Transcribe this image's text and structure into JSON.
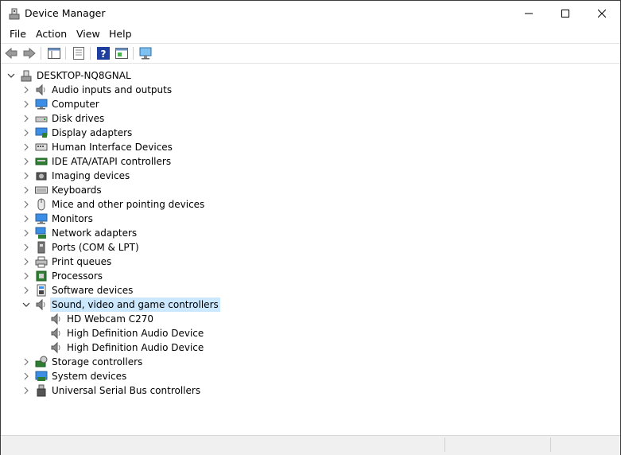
{
  "window": {
    "title": "Device Manager"
  },
  "menu": [
    "File",
    "Action",
    "View",
    "Help"
  ],
  "toolbar": {
    "buttons": [
      "back-icon",
      "forward-icon",
      "properties-icon",
      "update-driver-icon",
      "help-icon",
      "view-hidden-icon",
      "scan-hardware-icon"
    ]
  },
  "tree": {
    "root": "DESKTOP-NQ8GNAL",
    "categories": [
      {
        "label": "Audio inputs and outputs",
        "icon": "speaker-icon"
      },
      {
        "label": "Computer",
        "icon": "computer-icon"
      },
      {
        "label": "Disk drives",
        "icon": "disk-drive-icon"
      },
      {
        "label": "Display adapters",
        "icon": "display-adapter-icon"
      },
      {
        "label": "Human Interface Devices",
        "icon": "hid-icon"
      },
      {
        "label": "IDE ATA/ATAPI controllers",
        "icon": "ide-controller-icon"
      },
      {
        "label": "Imaging devices",
        "icon": "imaging-device-icon"
      },
      {
        "label": "Keyboards",
        "icon": "keyboard-icon"
      },
      {
        "label": "Mice and other pointing devices",
        "icon": "mouse-icon"
      },
      {
        "label": "Monitors",
        "icon": "monitor-icon"
      },
      {
        "label": "Network adapters",
        "icon": "network-adapter-icon"
      },
      {
        "label": "Ports (COM & LPT)",
        "icon": "port-icon"
      },
      {
        "label": "Print queues",
        "icon": "printer-icon"
      },
      {
        "label": "Processors",
        "icon": "processor-icon"
      },
      {
        "label": "Software devices",
        "icon": "software-device-icon"
      },
      {
        "label": "Sound, video and game controllers",
        "icon": "speaker-icon",
        "expanded": true,
        "selected": true,
        "children": [
          "HD Webcam C270",
          "High Definition Audio Device",
          "High Definition Audio Device"
        ]
      },
      {
        "label": "Storage controllers",
        "icon": "storage-controller-icon"
      },
      {
        "label": "System devices",
        "icon": "system-device-icon"
      },
      {
        "label": "Universal Serial Bus controllers",
        "icon": "usb-icon"
      }
    ]
  },
  "colors": {
    "selection": "#cce8ff",
    "accent": "#0078d7"
  }
}
